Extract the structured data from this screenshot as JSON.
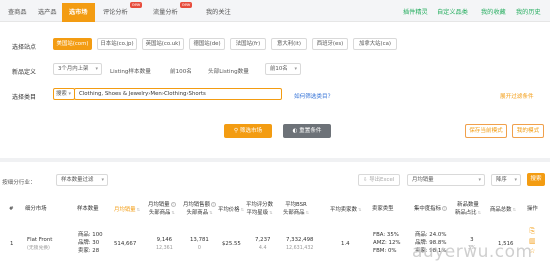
{
  "nav": {
    "tabs": [
      {
        "label": "查商品",
        "active": false
      },
      {
        "label": "选产品",
        "active": false
      },
      {
        "label": "选市场",
        "active": true
      },
      {
        "label": "评论分析",
        "active": false,
        "badge": "new"
      },
      {
        "label": "流量分析",
        "active": false,
        "badge": "new"
      },
      {
        "label": "我的关注",
        "active": false
      }
    ],
    "links": [
      "插件精灵",
      "自定义品类",
      "我的收藏",
      "我的历史"
    ]
  },
  "filters": {
    "site_label": "选择站点",
    "sites": [
      {
        "label": "美国站(com)",
        "active": true
      },
      {
        "label": "日本站(co.jp)",
        "active": false
      },
      {
        "label": "英国站(co.uk)",
        "active": false
      },
      {
        "label": "德国站(de)",
        "active": false
      },
      {
        "label": "法国站(fr)",
        "active": false
      },
      {
        "label": "意大利(it)",
        "active": false
      },
      {
        "label": "西班牙(es)",
        "active": false
      },
      {
        "label": "加拿大站(ca)",
        "active": false
      }
    ],
    "definition_label": "新品定义",
    "definition_value": "3个月内上架",
    "listing_count_label": "Listing样本数量",
    "listing_count_value": "前100名",
    "head_listing_label": "头部Listing数量",
    "head_listing_value": "前10名",
    "category_label": "选择类目",
    "category_prefix": "搜索",
    "category_path": "Clothing, Shoes & Jewelry›Men›Clothing›Shorts",
    "help_link": "如何筛选类目？",
    "expand_link": "展开过滤条件",
    "filter_button": "筛选市场",
    "reset_button": "重置条件",
    "save_template_button": "保存当前模式",
    "my_template_button": "我的模式"
  },
  "toolbar": {
    "filter_label": "按细分行业：",
    "filter_value": "样本数量过滤",
    "export_button": "导出Excel",
    "sort_by_value": "月均销量",
    "order_value": "降序",
    "search_button": "搜索"
  },
  "table": {
    "headers": [
      {
        "label": "#"
      },
      {
        "label": "细分市场"
      },
      {
        "label": "样本数量"
      },
      {
        "label": "月均销量",
        "highlight": true
      },
      {
        "label": "月均销量\n头部商品"
      },
      {
        "label": "月均销售额\n头部商品"
      },
      {
        "label": "平均价格"
      },
      {
        "label": "平均评分数\n平均星级"
      },
      {
        "label": "平均BSR\n头部商品"
      },
      {
        "label": "平均卖家数"
      },
      {
        "label": "卖家类型"
      },
      {
        "label": "集中度指标"
      },
      {
        "label": "新品数量\n新品占比"
      },
      {
        "label": "商品总数"
      },
      {
        "label": "操作"
      }
    ],
    "rows": [
      {
        "index": "1",
        "market": "Flat Front",
        "market_sub": "(无锁兑换)",
        "samples": [
          "商品: 100",
          "品牌: 30",
          "卖家: 28"
        ],
        "monthly_sales": "514,667",
        "head_sales": "9,146",
        "head_sales_sub": "12,361",
        "head_revenue": "13,781",
        "head_revenue_sub": "0",
        "avg_price": "$25.55",
        "avg_reviews": "7,237",
        "avg_rating": "4.4",
        "avg_bsr": "7,332,498",
        "avg_bsr_sub": "12,631,432",
        "avg_sellers": "1.4",
        "seller_types": [
          "FBA: 35%",
          "AMZ: 12%",
          "FBM: 0%"
        ],
        "concentration": [
          "商品: 24.0%",
          "品牌: 98.8%",
          "卖家: 98.1%"
        ],
        "new_count": "3",
        "new_ratio": "3%",
        "total_products": "1,516"
      }
    ]
  },
  "watermark": "auyerwu.com"
}
